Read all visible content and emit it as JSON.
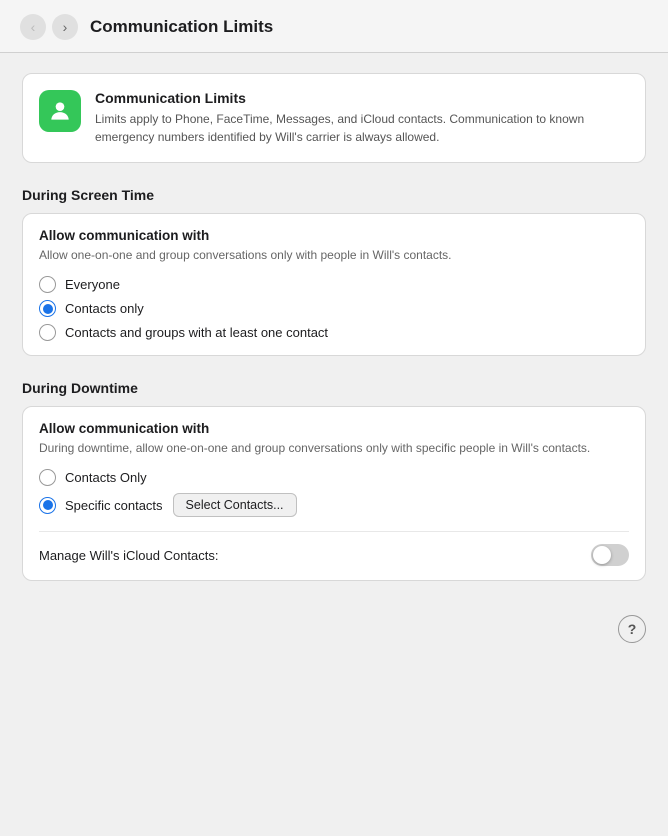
{
  "header": {
    "title": "Communication Limits",
    "back_label": "‹",
    "forward_label": "›"
  },
  "info_card": {
    "title": "Communication Limits",
    "description": "Limits apply to Phone, FaceTime, Messages, and iCloud contacts. Communication to known emergency numbers identified by Will's carrier is always allowed."
  },
  "screen_time_section": {
    "heading": "During Screen Time",
    "card": {
      "title": "Allow communication with",
      "subtitle": "Allow one-on-one and group conversations only with people in Will's contacts.",
      "options": [
        {
          "id": "everyone",
          "label": "Everyone",
          "selected": false
        },
        {
          "id": "contacts-only",
          "label": "Contacts only",
          "selected": true
        },
        {
          "id": "contacts-groups",
          "label": "Contacts and groups with at least one contact",
          "selected": false
        }
      ]
    }
  },
  "downtime_section": {
    "heading": "During Downtime",
    "card": {
      "title": "Allow communication with",
      "subtitle": "During downtime, allow one-on-one and group conversations only with specific people in Will's contacts.",
      "options": [
        {
          "id": "contacts-only-down",
          "label": "Contacts Only",
          "selected": false
        },
        {
          "id": "specific-contacts",
          "label": "Specific contacts",
          "selected": true
        }
      ],
      "select_button_label": "Select Contacts...",
      "toggle_row": {
        "label": "Manage Will's iCloud Contacts:",
        "enabled": false
      }
    }
  },
  "help_button_label": "?"
}
